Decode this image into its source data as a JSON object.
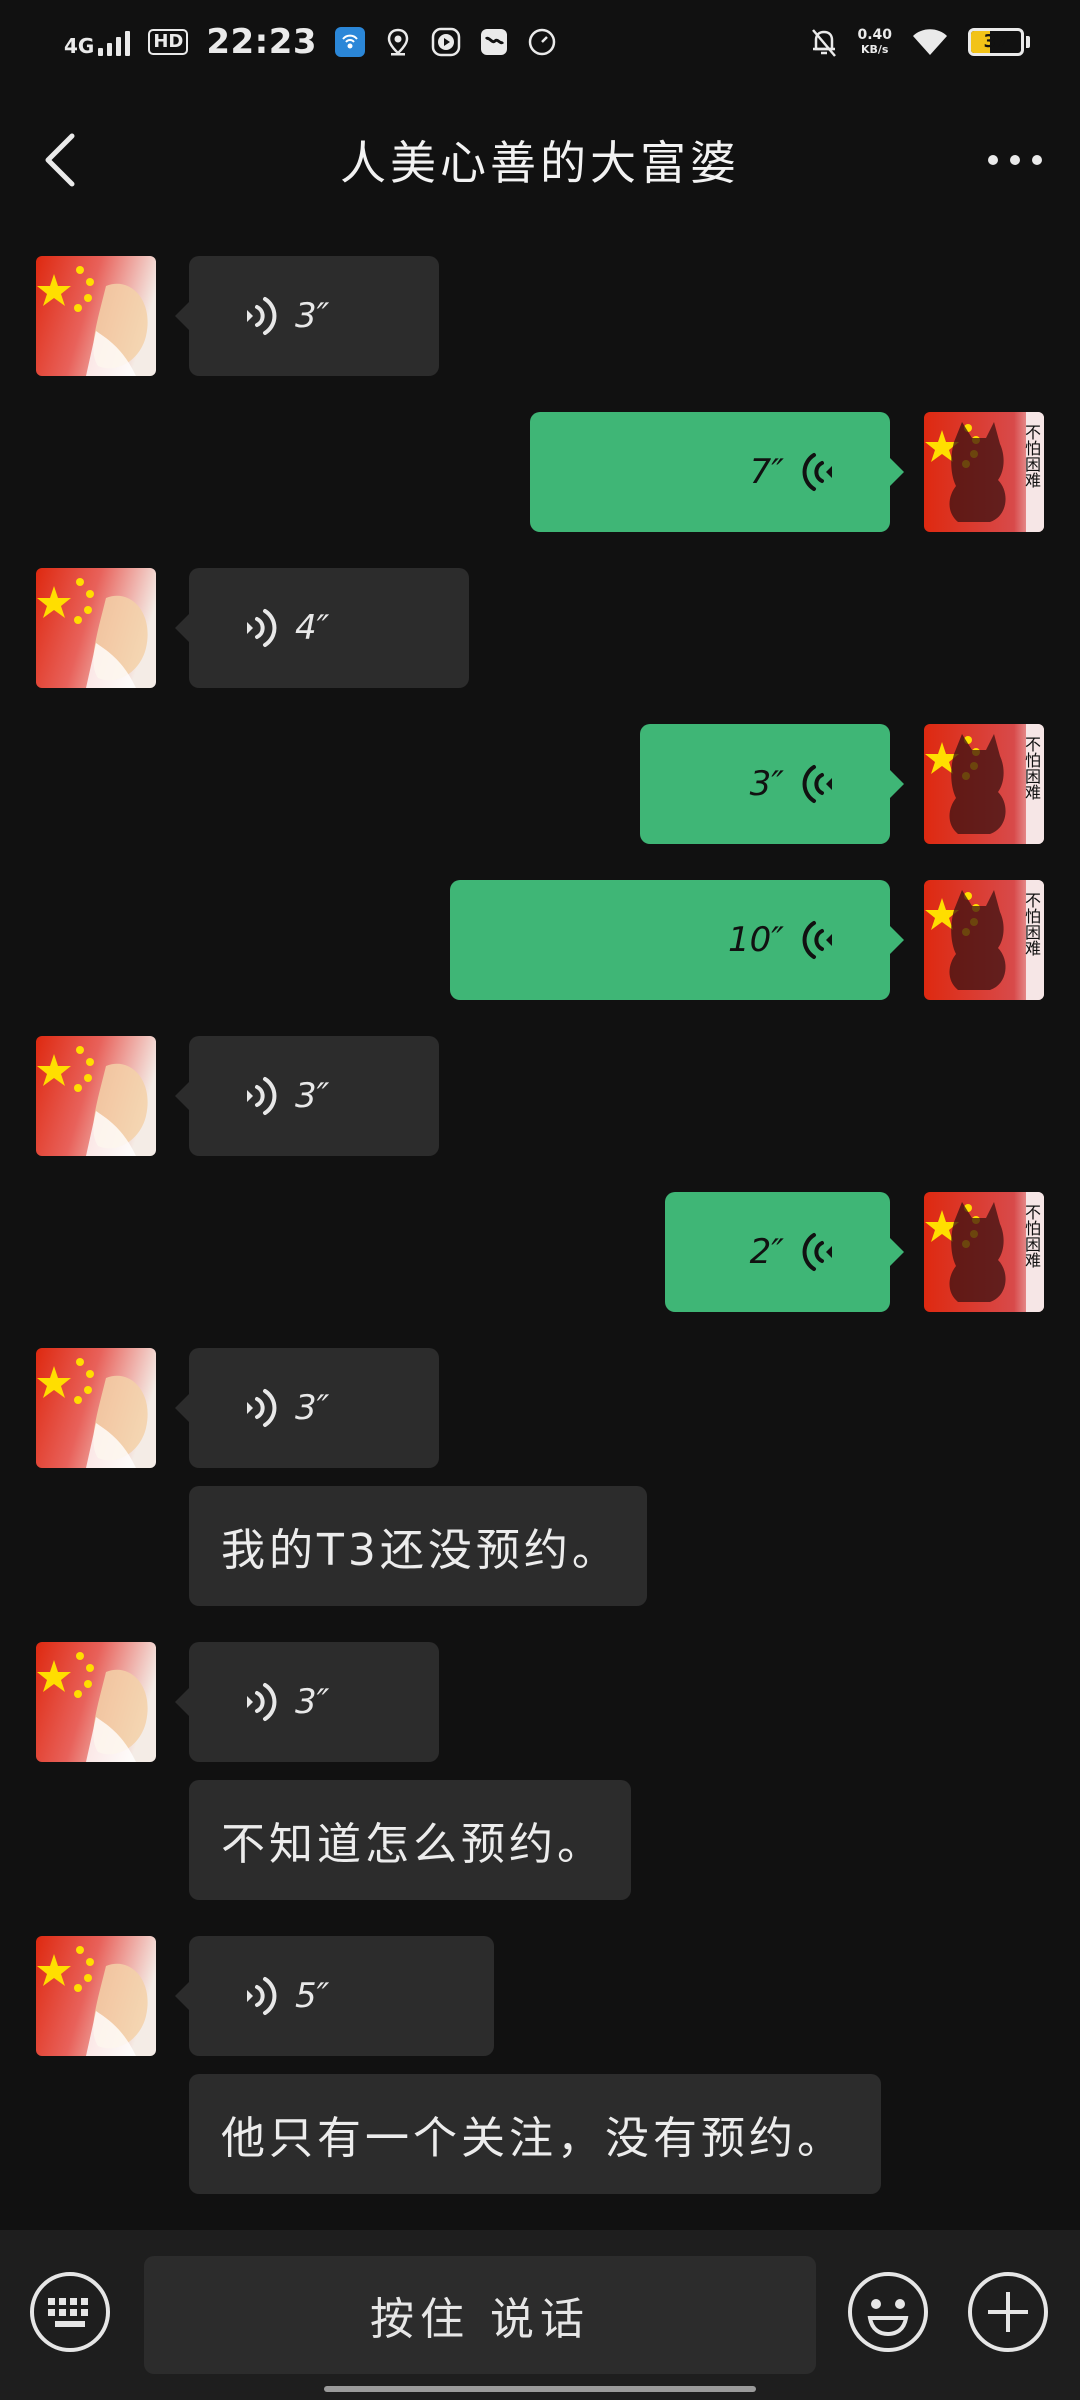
{
  "status_bar": {
    "network": "4G",
    "hd": "HD",
    "time": "22:23",
    "net_speed_value": "0.40",
    "net_speed_unit": "KB/s",
    "battery_level": 37
  },
  "header": {
    "title": "人美心善的大富婆"
  },
  "messages": [
    {
      "side": "in",
      "type": "voice",
      "duration": "3″"
    },
    {
      "side": "out",
      "type": "voice",
      "duration": "7″"
    },
    {
      "side": "in",
      "type": "voice",
      "duration": "4″"
    },
    {
      "side": "out",
      "type": "voice",
      "duration": "3″"
    },
    {
      "side": "out",
      "type": "voice",
      "duration": "10″"
    },
    {
      "side": "in",
      "type": "voice",
      "duration": "3″"
    },
    {
      "side": "out",
      "type": "voice",
      "duration": "2″"
    },
    {
      "side": "in",
      "type": "voice",
      "duration": "3″"
    },
    {
      "side": "in",
      "type": "text",
      "text": "我的T3还没预约。"
    },
    {
      "side": "in",
      "type": "voice",
      "duration": "3″"
    },
    {
      "side": "in",
      "type": "text",
      "text": "不知道怎么预约。"
    },
    {
      "side": "in",
      "type": "voice",
      "duration": "5″"
    },
    {
      "side": "in",
      "type": "text",
      "text": "他只有一个关注，没有预约。"
    }
  ],
  "avatar_out": {
    "caption": "不怕困难"
  },
  "input_bar": {
    "hold_to_talk": "按住 说话"
  },
  "colors": {
    "background": "#111111",
    "incoming_bubble": "#2c2c2c",
    "outgoing_bubble": "#3fb676",
    "battery_fill": "#f2c318"
  },
  "icons": [
    "back-arrow-icon",
    "more-icon",
    "voice-wave-icon",
    "keyboard-icon",
    "emoji-icon",
    "plus-icon"
  ]
}
